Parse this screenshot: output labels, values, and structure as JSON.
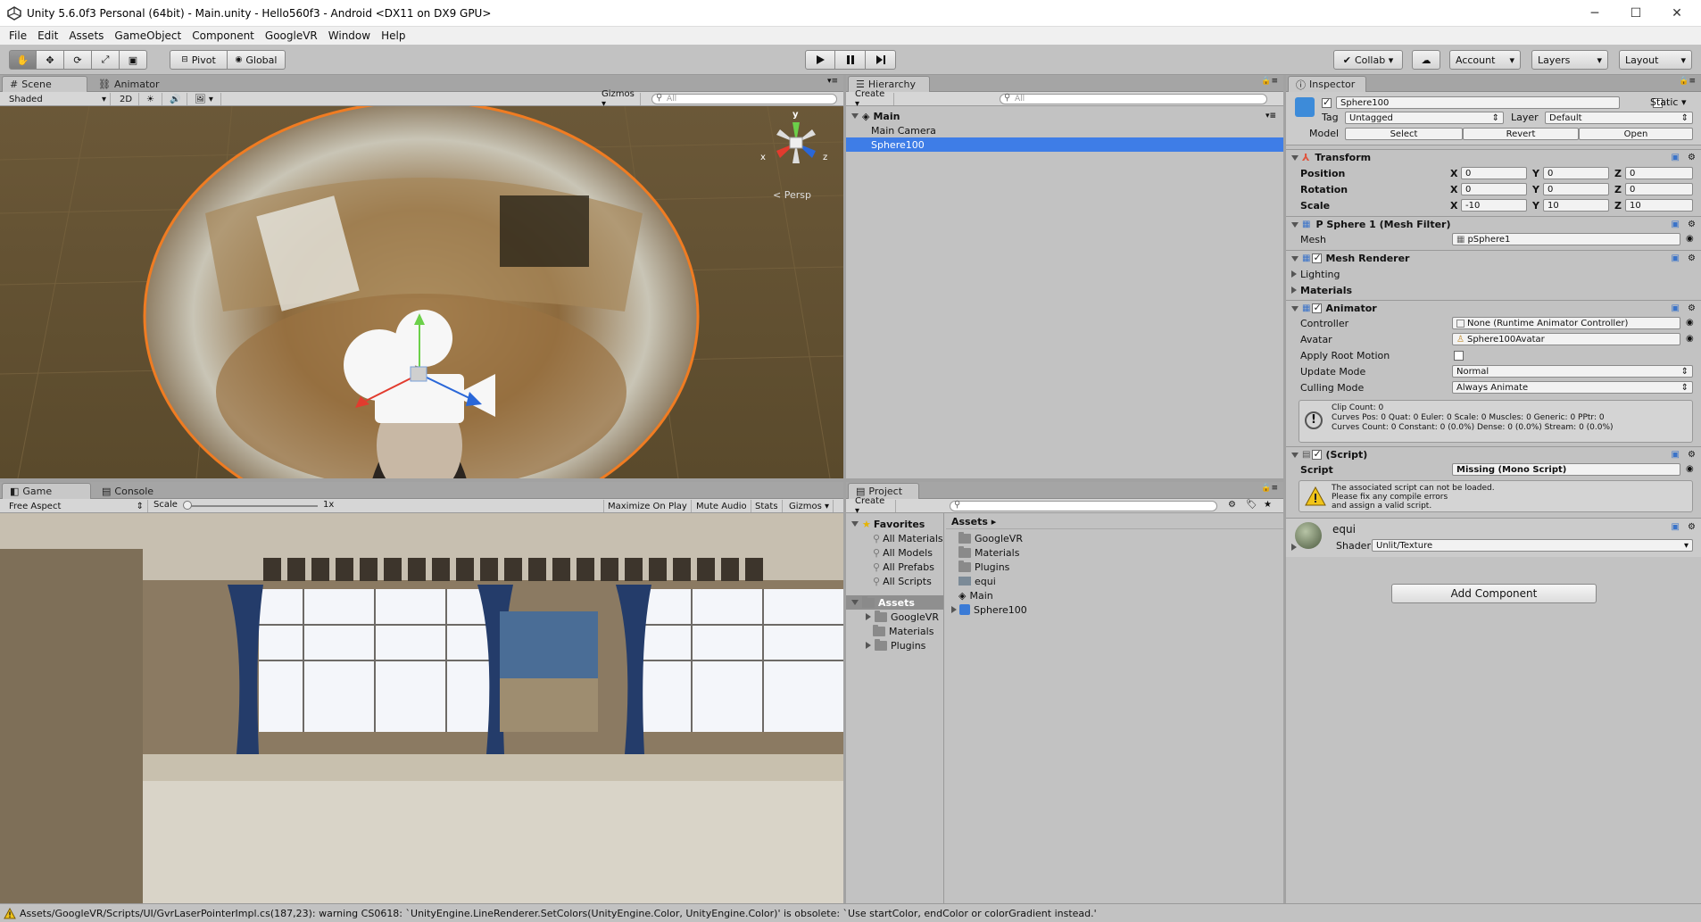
{
  "window": {
    "title": "Unity 5.6.0f3 Personal (64bit) - Main.unity - Hello560f3 - Android <DX11 on DX9 GPU>"
  },
  "menu": [
    "File",
    "Edit",
    "Assets",
    "GameObject",
    "Component",
    "GoogleVR",
    "Window",
    "Help"
  ],
  "toolbar": {
    "pivot": "Pivot",
    "global": "Global",
    "collab": "Collab ▾",
    "account": "Account",
    "layers": "Layers",
    "layout": "Layout"
  },
  "scene": {
    "tabs": [
      "Scene",
      "Animator"
    ],
    "shading": "Shaded",
    "mode2d": "2D",
    "gizmos": "Gizmos ▾",
    "search_placeholder": "All",
    "persp": "< Persp",
    "axis_y": "y",
    "axis_x": "x",
    "axis_z": "z"
  },
  "game": {
    "tabs": [
      "Game",
      "Console"
    ],
    "aspect": "Free Aspect",
    "scale_label": "Scale",
    "scale_value": "1x",
    "buttons": [
      "Maximize On Play",
      "Mute Audio",
      "Stats",
      "Gizmos ▾"
    ]
  },
  "hierarchy": {
    "tab": "Hierarchy",
    "create": "Create ▾",
    "search_placeholder": "All",
    "scene_name": "Main",
    "items": [
      "Main Camera",
      "Sphere100"
    ],
    "selected": "Sphere100"
  },
  "project": {
    "tab": "Project",
    "create": "Create ▾",
    "favorites_label": "Favorites",
    "favorites": [
      "All Materials",
      "All Models",
      "All Prefabs",
      "All Scripts"
    ],
    "assets_label": "Assets",
    "tree_assets": [
      "GoogleVR",
      "Materials",
      "Plugins"
    ],
    "breadcrumb": "Assets ▸",
    "content": [
      {
        "name": "GoogleVR",
        "type": "folder"
      },
      {
        "name": "Materials",
        "type": "folder"
      },
      {
        "name": "Plugins",
        "type": "folder"
      },
      {
        "name": "equi",
        "type": "image"
      },
      {
        "name": "Main",
        "type": "scene"
      },
      {
        "name": "Sphere100",
        "type": "prefab"
      }
    ]
  },
  "inspector": {
    "tab": "Inspector",
    "object_name": "Sphere100",
    "static_label": "Static ▾",
    "tag_label": "Tag",
    "tag_value": "Untagged",
    "layer_label": "Layer",
    "layer_value": "Default",
    "model_label": "Model",
    "model_buttons": [
      "Select",
      "Revert",
      "Open"
    ],
    "transform": {
      "title": "Transform",
      "rows": [
        {
          "label": "Position",
          "x": "0",
          "y": "0",
          "z": "0"
        },
        {
          "label": "Rotation",
          "x": "0",
          "y": "0",
          "z": "0"
        },
        {
          "label": "Scale",
          "x": "-10",
          "y": "10",
          "z": "10"
        }
      ],
      "axes": [
        "X",
        "Y",
        "Z"
      ]
    },
    "mesh_filter": {
      "title": "P Sphere 1 (Mesh Filter)",
      "mesh_label": "Mesh",
      "mesh_value": "pSphere1"
    },
    "mesh_renderer": {
      "title": "Mesh Renderer",
      "lighting": "Lighting",
      "materials": "Materials"
    },
    "animator": {
      "title": "Animator",
      "rows": [
        {
          "label": "Controller",
          "value": "None (Runtime Animator Controller)"
        },
        {
          "label": "Avatar",
          "value": "Sphere100Avatar"
        },
        {
          "label": "Apply Root Motion",
          "value": ""
        },
        {
          "label": "Update Mode",
          "value": "Normal"
        },
        {
          "label": "Culling Mode",
          "value": "Always Animate"
        }
      ],
      "info": [
        "Clip Count: 0",
        "Curves Pos: 0 Quat: 0 Euler: 0 Scale: 0 Muscles: 0 Generic: 0 PPtr: 0",
        "Curves Count: 0 Constant: 0 (0.0%) Dense: 0 (0.0%) Stream: 0 (0.0%)"
      ]
    },
    "script": {
      "title": "(Script)",
      "script_label": "Script",
      "script_value": "Missing (Mono Script)",
      "warning": [
        "The associated script can not be loaded.",
        "Please fix any compile errors",
        "and assign a valid script."
      ]
    },
    "material": {
      "name": "equi",
      "shader_label": "Shader",
      "shader_value": "Unlit/Texture"
    },
    "add_component": "Add Component"
  },
  "status": {
    "message": "Assets/GoogleVR/Scripts/UI/GvrLaserPointerImpl.cs(187,23): warning CS0618: `UnityEngine.LineRenderer.SetColors(UnityEngine.Color, UnityEngine.Color)' is obsolete: `Use startColor, endColor or colorGradient instead.'"
  },
  "colors": {
    "selection": "#3e7de7",
    "orange_outline": "#f07c22",
    "scene_bg": "#5b4a2c"
  }
}
